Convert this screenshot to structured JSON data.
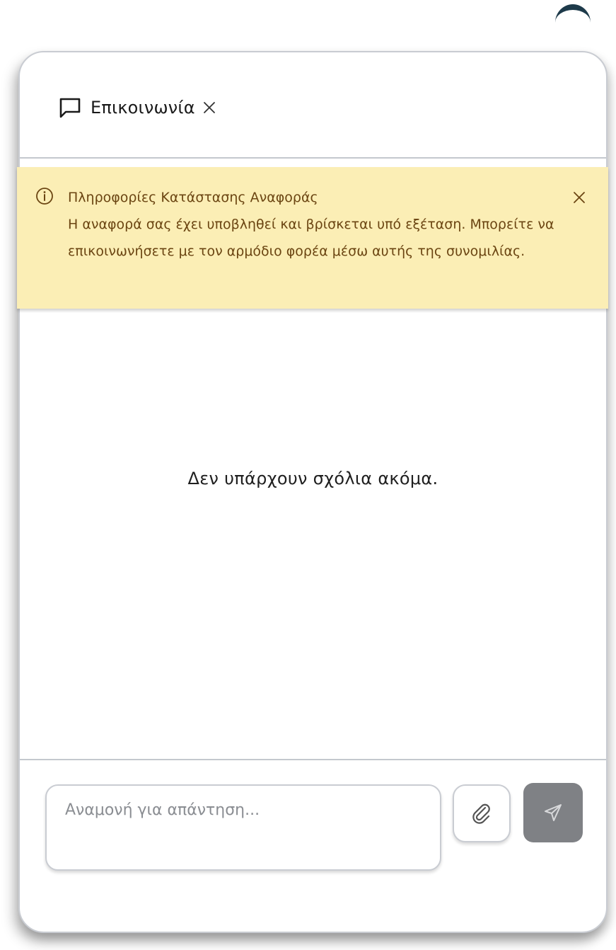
{
  "window": {
    "tab_label": "Επικοινωνία"
  },
  "banner": {
    "title": "Πληροφορίες Κατάστασης Αναφοράς",
    "body": "Η αναφορά σας έχει υποβληθεί και βρίσκεται υπό εξέταση. Μπορείτε να επικοινωνήσετε με τον αρμόδιο φορέα μέσω αυτής της συνομιλίας.",
    "background_color": "#fbeeb5",
    "text_color": "#6b4512"
  },
  "comments": {
    "empty_text": "Δεν υπάρχουν σχόλια ακόμα."
  },
  "composer": {
    "placeholder": "Αναμονή για απάντηση...",
    "value": "",
    "send_button_color": "#7f8185"
  },
  "icons": {
    "tab": "chat-bubble-icon",
    "tab_close": "close-icon",
    "banner_info": "info-icon",
    "banner_close": "close-icon",
    "attach": "paperclip-icon",
    "send": "send-icon"
  }
}
